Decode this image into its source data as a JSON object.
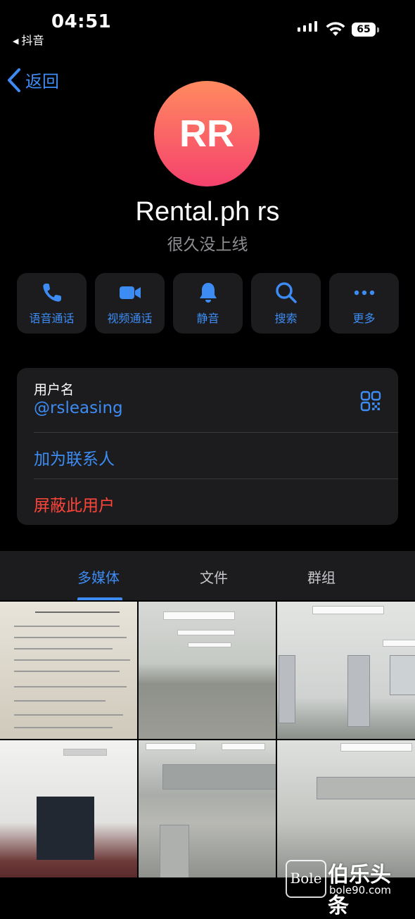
{
  "status_bar": {
    "time": "04:51",
    "back_app": "抖音",
    "battery": "65"
  },
  "nav": {
    "back_label": "返回"
  },
  "profile": {
    "initials": "RR",
    "name": "Rental.ph rs",
    "last_seen": "很久没上线",
    "avatar_gradient": [
      "#ff8a5f",
      "#f5426d"
    ]
  },
  "actions": [
    {
      "label": "语音通话",
      "icon": "phone-icon"
    },
    {
      "label": "视频通话",
      "icon": "video-icon"
    },
    {
      "label": "静音",
      "icon": "bell-icon"
    },
    {
      "label": "搜索",
      "icon": "search-icon"
    },
    {
      "label": "更多",
      "icon": "more-icon"
    }
  ],
  "info": {
    "username_label": "用户名",
    "username": "@rsleasing",
    "add_contact": "加为联系人",
    "block_user": "屏蔽此用户"
  },
  "tabs": [
    {
      "label": "多媒体",
      "active": true
    },
    {
      "label": "文件",
      "active": false
    },
    {
      "label": "群组",
      "active": false
    }
  ],
  "watermark": {
    "logo": "Bole",
    "name": "伯乐头条",
    "url": "bole90.com"
  },
  "colors": {
    "accent": "#3d8cf4",
    "danger": "#ff453a",
    "card": "#1c1c1e",
    "background": "#000000"
  }
}
